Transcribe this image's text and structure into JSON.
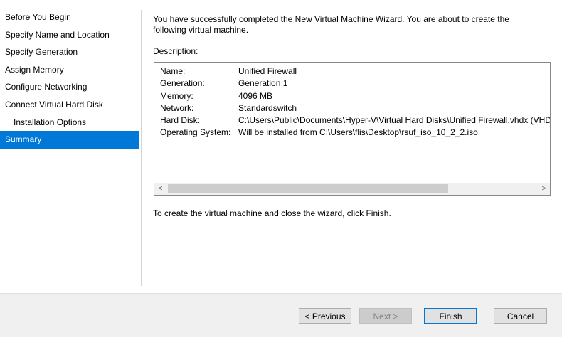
{
  "nav": {
    "items": [
      {
        "label": "Before You Begin",
        "selected": false,
        "sub": false
      },
      {
        "label": "Specify Name and Location",
        "selected": false,
        "sub": false
      },
      {
        "label": "Specify Generation",
        "selected": false,
        "sub": false
      },
      {
        "label": "Assign Memory",
        "selected": false,
        "sub": false
      },
      {
        "label": "Configure Networking",
        "selected": false,
        "sub": false
      },
      {
        "label": "Connect Virtual Hard Disk",
        "selected": false,
        "sub": false
      },
      {
        "label": "Installation Options",
        "selected": false,
        "sub": true
      },
      {
        "label": "Summary",
        "selected": true,
        "sub": false
      }
    ]
  },
  "main": {
    "intro": "You have successfully completed the New Virtual Machine Wizard. You are about to create the following virtual machine.",
    "description_label": "Description:",
    "summary_rows": [
      {
        "key": "Name:",
        "value": "Unified Firewall"
      },
      {
        "key": "Generation:",
        "value": "Generation 1"
      },
      {
        "key": "Memory:",
        "value": "4096 MB"
      },
      {
        "key": "Network:",
        "value": "Standardswitch"
      },
      {
        "key": "Hard Disk:",
        "value": "C:\\Users\\Public\\Documents\\Hyper-V\\Virtual Hard Disks\\Unified Firewall.vhdx (VHDX"
      },
      {
        "key": "Operating System:",
        "value": "Will be installed from C:\\Users\\flis\\Desktop\\rsuf_iso_10_2_2.iso"
      }
    ],
    "scroll_left": "<",
    "scroll_right": ">",
    "finish_note": "To create the virtual machine and close the wizard, click Finish."
  },
  "buttons": {
    "previous": "< Previous",
    "next": "Next >",
    "finish": "Finish",
    "cancel": "Cancel"
  },
  "colors": {
    "selection": "#0078d7",
    "footer_bg": "#f0f0f0"
  }
}
